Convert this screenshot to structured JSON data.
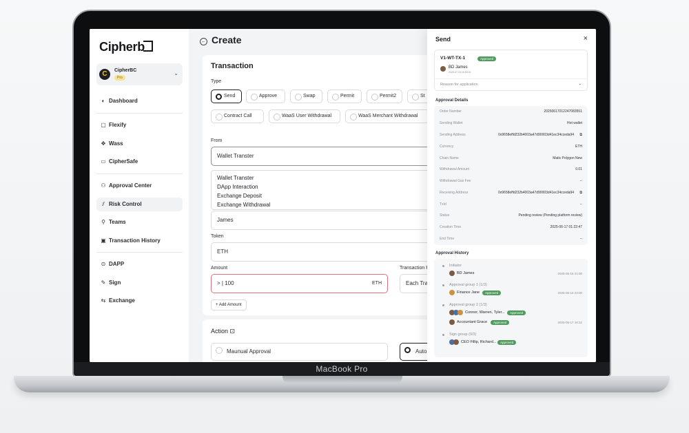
{
  "device": {
    "label": "MacBook Pro"
  },
  "sidebar": {
    "logo": "Cipherb",
    "org": {
      "name": "CipherBC",
      "plan": "Pro",
      "avatar_letter": "C"
    },
    "items": [
      {
        "label": "Dashboard",
        "icon": "dashboard-icon",
        "glyph": "◐"
      },
      {
        "label": "Flexify",
        "icon": "flexify-icon",
        "glyph": "▢"
      },
      {
        "label": "Wass",
        "icon": "wass-icon",
        "glyph": "✥"
      },
      {
        "label": "CipherSafe",
        "icon": "safe-icon",
        "glyph": "▭"
      },
      {
        "label": "Approval Center",
        "icon": "approval-icon",
        "glyph": "⚇"
      },
      {
        "label": "Risk Control",
        "icon": "risk-icon",
        "glyph": "⫽"
      },
      {
        "label": "Teams",
        "icon": "teams-icon",
        "glyph": "⚲"
      },
      {
        "label": "Transaction History",
        "icon": "history-icon",
        "glyph": "▣"
      },
      {
        "label": "DAPP",
        "icon": "dapp-icon",
        "glyph": "⊙"
      },
      {
        "label": "Sign",
        "icon": "sign-icon",
        "glyph": "✎"
      },
      {
        "label": "Exchange",
        "icon": "exchange-icon",
        "glyph": "⇆"
      }
    ]
  },
  "main": {
    "title": "Create",
    "transaction": {
      "heading": "Transaction",
      "type_label": "Type",
      "types_row1": [
        "Send",
        "Approve",
        "Swap",
        "Permit",
        "Permit2",
        "St"
      ],
      "types_row2": [
        "Contract Call",
        "WaaS User Withdrawal",
        "WaaS Merchant Withdrawal"
      ],
      "from_label": "From",
      "from_value": "Wallet Transter",
      "from_options": [
        "Wallet Transter",
        "DApp Interaction",
        "Exchange Deposit",
        "Exchange Withdrawal"
      ],
      "wallet_value": "James",
      "token_label": "Token",
      "token_value": "ETH",
      "amount_label": "Amount",
      "amount_value": "100",
      "amount_unit": "ETH",
      "amount_prefix": ">",
      "transaction_label": "Transaction F",
      "each_value": "Each Tra",
      "add_amount": "+ Add Amount"
    },
    "action": {
      "heading": "Action",
      "manual": "Maunual Approval",
      "auto": "Auto"
    }
  },
  "drawer": {
    "title": "Send",
    "close": "×",
    "tx": {
      "id": "V1-WT-TX-1",
      "status": "Approved",
      "user": "BD James",
      "date": "2025-07-10 16:59:32",
      "reason": "Reason for application"
    },
    "details_title": "Approval Details",
    "details": [
      {
        "k": "Order Number",
        "v": "20250617012247083551"
      },
      {
        "k": "Sending Wallet",
        "v": "Hot wallet"
      },
      {
        "k": "Sending Address",
        "v": "0x9658effd232b4003a47d90003d41ec34cceda94"
      },
      {
        "k": "Currency",
        "v": "ETH"
      },
      {
        "k": "Chain Name",
        "v": "Matic Polygon New"
      },
      {
        "k": "Withdrawal Amount",
        "v": "0.01"
      },
      {
        "k": "Withdrawal Gas Fee",
        "v": "--"
      },
      {
        "k": "Receiving Address",
        "v": "0x9658effd232b4003a47d90003d41ec34cceda94"
      },
      {
        "k": "TxId",
        "v": "--"
      },
      {
        "k": "Status",
        "v": "Pending review (Pending platform review)"
      },
      {
        "k": "Creation Time",
        "v": "2025-06-17 01:22:47"
      },
      {
        "k": "End Time",
        "v": "--"
      }
    ],
    "history_title": "Approval History",
    "history": {
      "initiator_label": "Initiator",
      "initiator": "BD James",
      "initiator_time": "2025-06-15 21:00",
      "g1_label": "Approval group 1 (1/3)",
      "g1_user": "Finance Jane",
      "g1_badge": "Approved",
      "g1_time": "2025-06-16 23:00",
      "g2_label": "Approval group 2 (1/3)",
      "g2_users": "Connor, Warren, Tyler...",
      "g2_badge": "Approved",
      "g2_user2": "Accountant Grace",
      "g2_badge2": "Approved",
      "g2_time": "2025-06-17 16:32",
      "sign_label": "Sign group (0/3)",
      "sign_users": "CEO Fillip, Richard...",
      "sign_badge": "Approved"
    }
  }
}
